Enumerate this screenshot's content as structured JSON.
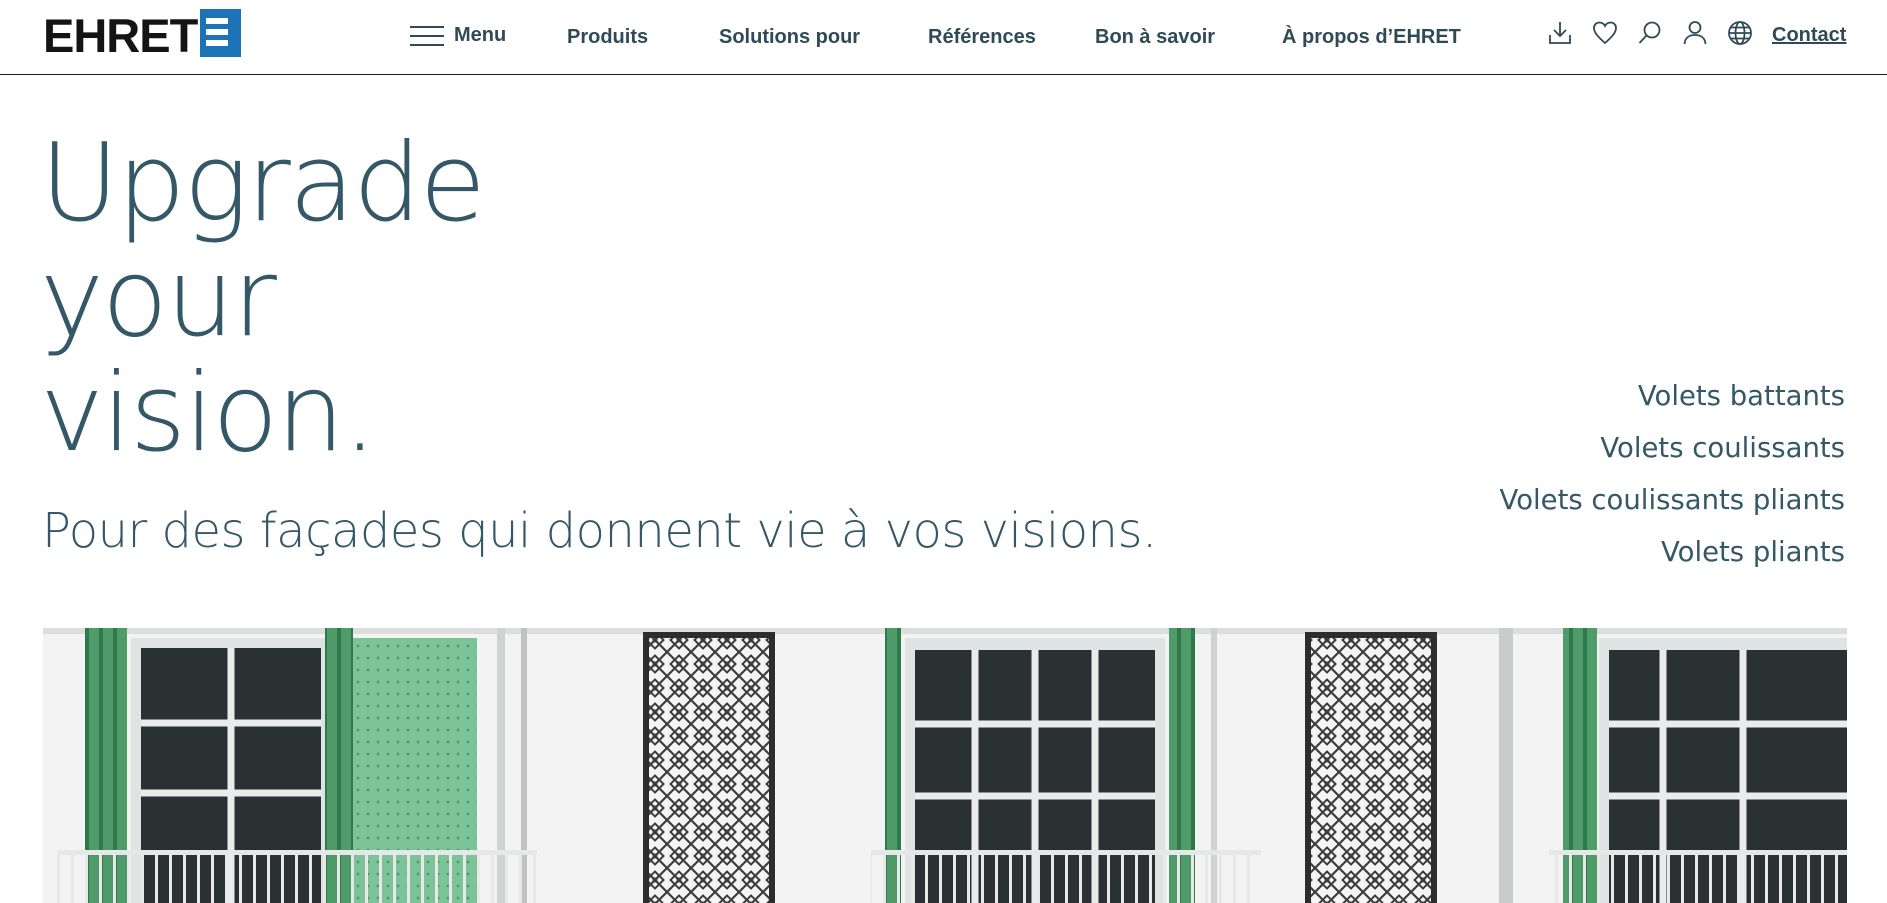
{
  "header": {
    "logo_text": "EHRET",
    "menu_label": "Menu",
    "nav": [
      {
        "label": "Produits"
      },
      {
        "label": "Solutions pour"
      },
      {
        "label": "Références"
      },
      {
        "label": "Bon à savoir"
      },
      {
        "label": "À propos d’EHRET"
      }
    ],
    "icons": [
      "download-icon",
      "heart-icon",
      "search-icon",
      "user-icon",
      "globe-icon"
    ],
    "contact_label": "Contact"
  },
  "hero": {
    "headline_lines": [
      "Upgrade",
      "your",
      "vision."
    ],
    "subline": "Pour des façades qui donnent vie à vos visions.",
    "links": [
      {
        "label": "Volets battants"
      },
      {
        "label": "Volets coulissants"
      },
      {
        "label": "Volets coulissants pliants"
      },
      {
        "label": "Volets pliants"
      }
    ]
  },
  "colors": {
    "text": "#345868",
    "nav_text": "#2f4a57",
    "logo_blue": "#1c73b8",
    "shutter_green": "#5aa676",
    "wall": "#f2f3f2"
  },
  "image": {
    "description_icon": "facade-photo"
  }
}
